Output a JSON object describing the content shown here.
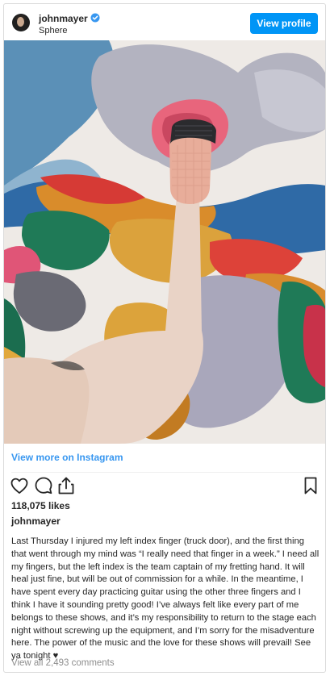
{
  "post": {
    "username": "johnmayer",
    "location": "Sphere",
    "view_profile_label": "View profile",
    "view_more_label": "View more on Instagram",
    "likes": "118,075 likes",
    "caption_username": "johnmayer",
    "caption": "Last Thursday I injured my left index finger (truck door), and the first thing that went through my mind was “I really need that finger in a week.” I need all my fingers, but the left index is the team captain of my fretting hand. It will heal just fine, but will be out of commission for a while. In the meantime, I have spent every day practicing guitar using the other three fingers and I think I have it sounding pretty good! I’ve always felt like every part of me belongs to these shows, and it’s my responsibility to return to the stage each night without screwing up the equipment, and I’m sorry for the misadventure here. The power of the music and the love for these shows will prevail! See ya tonight ♥",
    "comments_label": "View all 2,493 comments"
  },
  "icons": {
    "verified": "verified-badge-icon",
    "like": "heart-icon",
    "comment": "comment-bubble-icon",
    "share": "share-icon",
    "save": "bookmark-icon"
  },
  "colors": {
    "accent": "#0095f6",
    "link": "#3897f0",
    "muted": "#8e8e8e"
  }
}
